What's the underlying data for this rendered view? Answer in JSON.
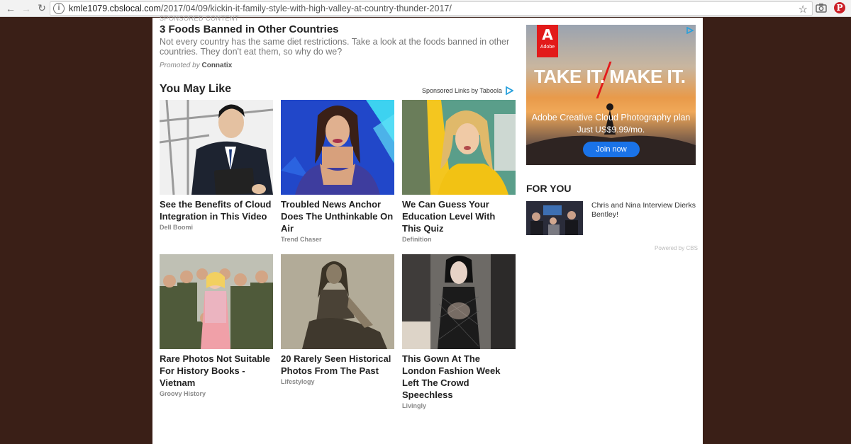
{
  "browser": {
    "url_host": "kmle1079.cbslocal.com",
    "url_path": "/2017/04/09/kickin-it-family-style-with-high-valley-at-country-thunder-2017/"
  },
  "promo": {
    "sponsored_label": "SPONSORED CONTENT",
    "title": "3 Foods Banned in Other Countries",
    "description": "Not every country has the same diet restrictions. Take a look at the foods banned in other countries. They don't eat them, so why do we?",
    "promoted_by_label": "Promoted by",
    "promoted_by": "Connatix"
  },
  "you_may_like": {
    "title": "You May Like",
    "sponsored_links": "Sponsored Links by Taboola",
    "cards": [
      {
        "title": "See the Benefits of Cloud Integration in This Video",
        "source": "Dell Boomi"
      },
      {
        "title": "Troubled News Anchor Does The Unthinkable On Air",
        "source": "Trend Chaser"
      },
      {
        "title": "We Can Guess Your Education Level With This Quiz",
        "source": "Definition"
      },
      {
        "title": "Rare Photos Not Suitable For History Books - Vietnam",
        "source": "Groovy History"
      },
      {
        "title": "20 Rarely Seen Historical Photos From The Past",
        "source": "Lifestylogy"
      },
      {
        "title": "This Gown At The London Fashion Week Left The Crowd Speechless",
        "source": "Livingly"
      }
    ]
  },
  "ad": {
    "brand": "Adobe",
    "headline": "TAKE IT. MAKE IT.",
    "subtitle": "Adobe Creative Cloud Photography plan",
    "price": "Just US$9.99/mo.",
    "button": "Join now"
  },
  "for_you": {
    "title": "FOR YOU",
    "item": "Chris and Nina Interview Dierks Bentley!",
    "powered_by": "Powered by CBS"
  }
}
